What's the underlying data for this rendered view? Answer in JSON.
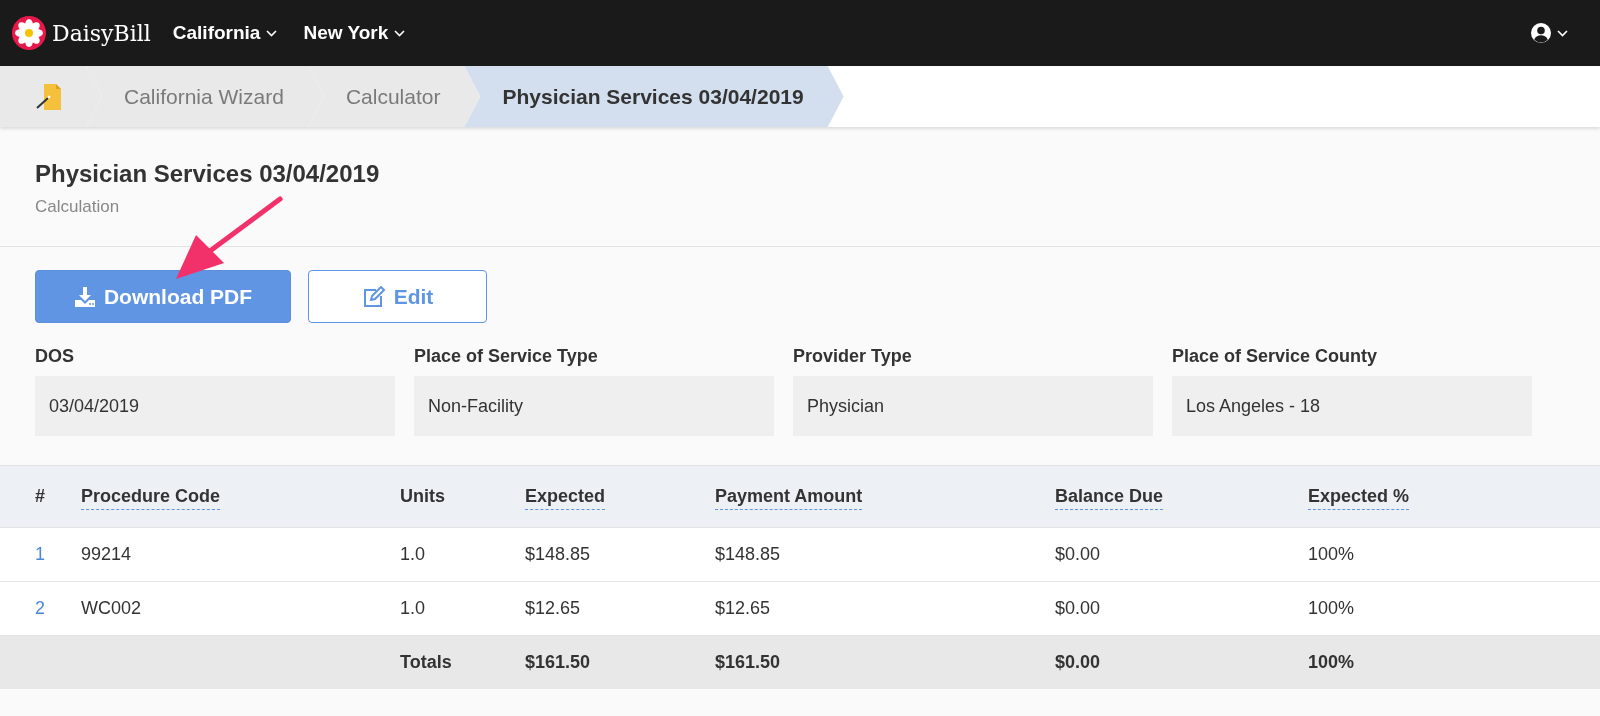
{
  "navbar": {
    "brand": "DaisyBill",
    "menus": [
      {
        "label": "California"
      },
      {
        "label": "New York"
      }
    ]
  },
  "breadcrumb": [
    {
      "kind": "home",
      "selected": false
    },
    {
      "label": "California Wizard",
      "kind": "link",
      "selected": false
    },
    {
      "label": "Calculator",
      "kind": "link",
      "selected": false
    },
    {
      "label": "Physician Services 03/04/2019",
      "kind": "link",
      "selected": true
    }
  ],
  "header": {
    "title": "Physician Services 03/04/2019",
    "subtitle": "Calculation"
  },
  "buttons": [
    {
      "label": "Download PDF",
      "kind": "primary"
    },
    {
      "label": "Edit",
      "kind": "outline"
    }
  ],
  "fields": [
    {
      "label": "DOS",
      "value": "03/04/2019"
    },
    {
      "label": "Place of Service Type",
      "value": "Non-Facility"
    },
    {
      "label": "Provider Type",
      "value": "Physician"
    },
    {
      "label": "Place of Service County",
      "value": "Los Angeles - 18"
    }
  ],
  "table": {
    "columns": [
      {
        "label": "#",
        "dotted_underline": false
      },
      {
        "label": "Procedure Code",
        "dotted_underline": true
      },
      {
        "label": "Units",
        "dotted_underline": false
      },
      {
        "label": "Expected",
        "dotted_underline": true
      },
      {
        "label": "Payment Amount",
        "dotted_underline": true
      },
      {
        "label": "Balance Due",
        "dotted_underline": true
      },
      {
        "label": "Expected %",
        "dotted_underline": true
      }
    ],
    "rows": [
      [
        "1",
        "99214",
        "1.0",
        "$148.85",
        "$148.85",
        "$0.00",
        "100%"
      ],
      [
        "2",
        "WC002",
        "1.0",
        "$12.65",
        "$12.65",
        "$0.00",
        "100%"
      ]
    ],
    "totals": {
      "label": "Totals",
      "values": [
        "$161.50",
        "$161.50",
        "$0.00",
        "100%"
      ]
    }
  }
}
